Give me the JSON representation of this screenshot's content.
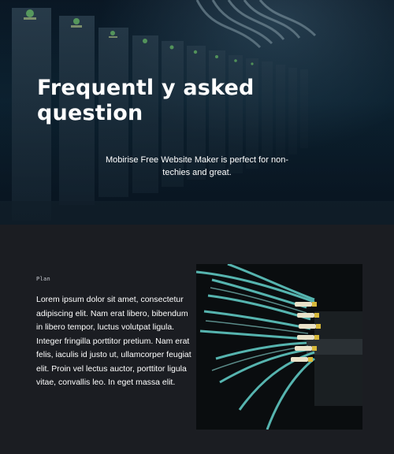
{
  "hero": {
    "title": "Frequentl y asked question",
    "subtitle": "Mobirise Free Website Maker is perfect for non-techies and great.",
    "background_image": "server-rack-photo"
  },
  "section": {
    "eyebrow": "Plan",
    "body": "Lorem ipsum dolor sit amet, consectetur adipiscing elit. Nam erat libero, bibendum in libero tempor, luctus volutpat ligula. Integer fringilla porttitor pretium. Nam erat felis, iaculis id justo ut, ullamcorper feugiat elit. Proin vel lectus auctor, porttitor ligula vitae, convallis leo. In eget massa elit.",
    "image": "fiber-cables-photo"
  },
  "colors": {
    "page_background": "#1b1d22",
    "hero_tint": "#0f2a3b",
    "text": "#ffffff",
    "cable": "#5fc7c1"
  }
}
